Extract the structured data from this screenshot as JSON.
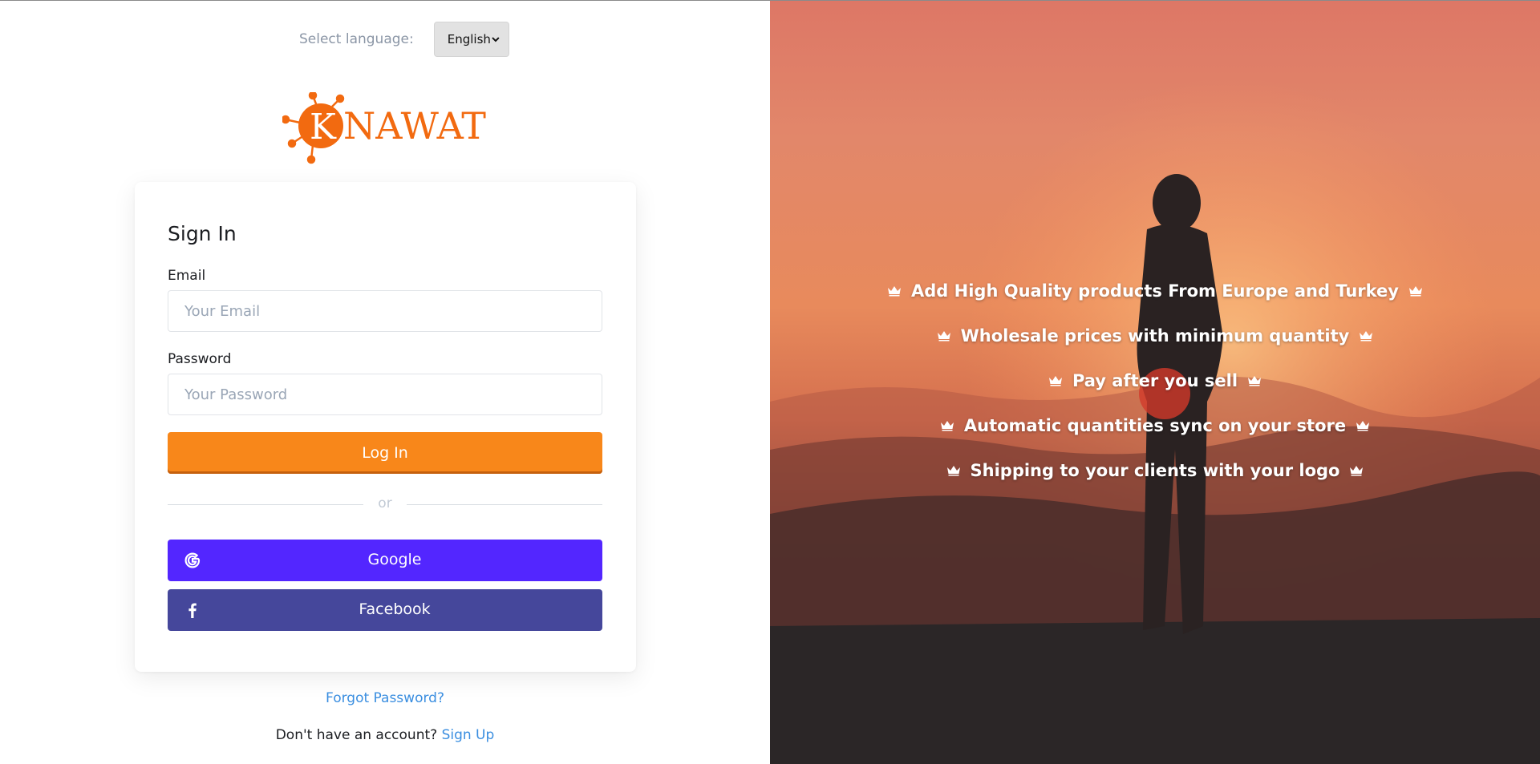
{
  "language": {
    "label": "Select language:",
    "selected": "English"
  },
  "brand": {
    "name": "NAWAT",
    "initial": "K"
  },
  "signin": {
    "title": "Sign In",
    "email_label": "Email",
    "email_placeholder": "Your Email",
    "email_value": "",
    "password_label": "Password",
    "password_placeholder": "Your Password",
    "password_value": "",
    "login_button": "Log In",
    "divider": "or",
    "google_button": "Google",
    "facebook_button": "Facebook"
  },
  "footer": {
    "forgot": "Forgot Password?",
    "no_account": "Don't have an account?",
    "signup": "Sign Up"
  },
  "features": [
    "Add High Quality products From Europe and Turkey",
    "Wholesale prices with minimum quantity",
    "Pay after you sell",
    "Automatic quantities sync on your store",
    "Shipping to your clients with your logo"
  ],
  "colors": {
    "accent": "#f8871a",
    "google": "#5326ff",
    "facebook": "#45479b",
    "link": "#3a8ee0",
    "brand_orange": "#f26a10"
  },
  "icons": [
    "chevron-down-icon",
    "google-icon",
    "facebook-icon",
    "crown-icon"
  ]
}
